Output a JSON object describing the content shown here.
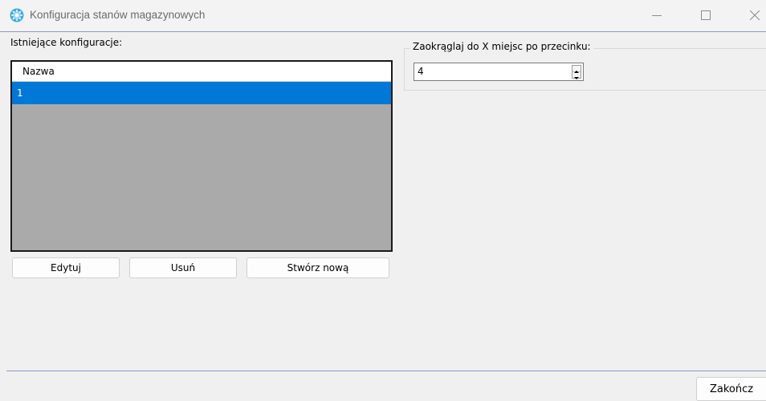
{
  "window": {
    "title": "Konfiguracja stanów magazynowych",
    "icon": "gear-icon",
    "controls": [
      "minimize-icon",
      "maximize-icon",
      "close-icon"
    ]
  },
  "configs": {
    "label": "Istniejące konfiguracje:",
    "columns": [
      "Nazwa"
    ],
    "rows": [
      {
        "name": "1",
        "selected": true
      }
    ],
    "selection_color": "#0078d7"
  },
  "buttons": {
    "edit": "Edytuj",
    "delete": "Usuń",
    "create": "Stwórz nową"
  },
  "rounding": {
    "label": "Zaokrąglaj do X miejsc po przecinku:",
    "value": "4"
  },
  "footer": {
    "finish": "Zakończ"
  }
}
